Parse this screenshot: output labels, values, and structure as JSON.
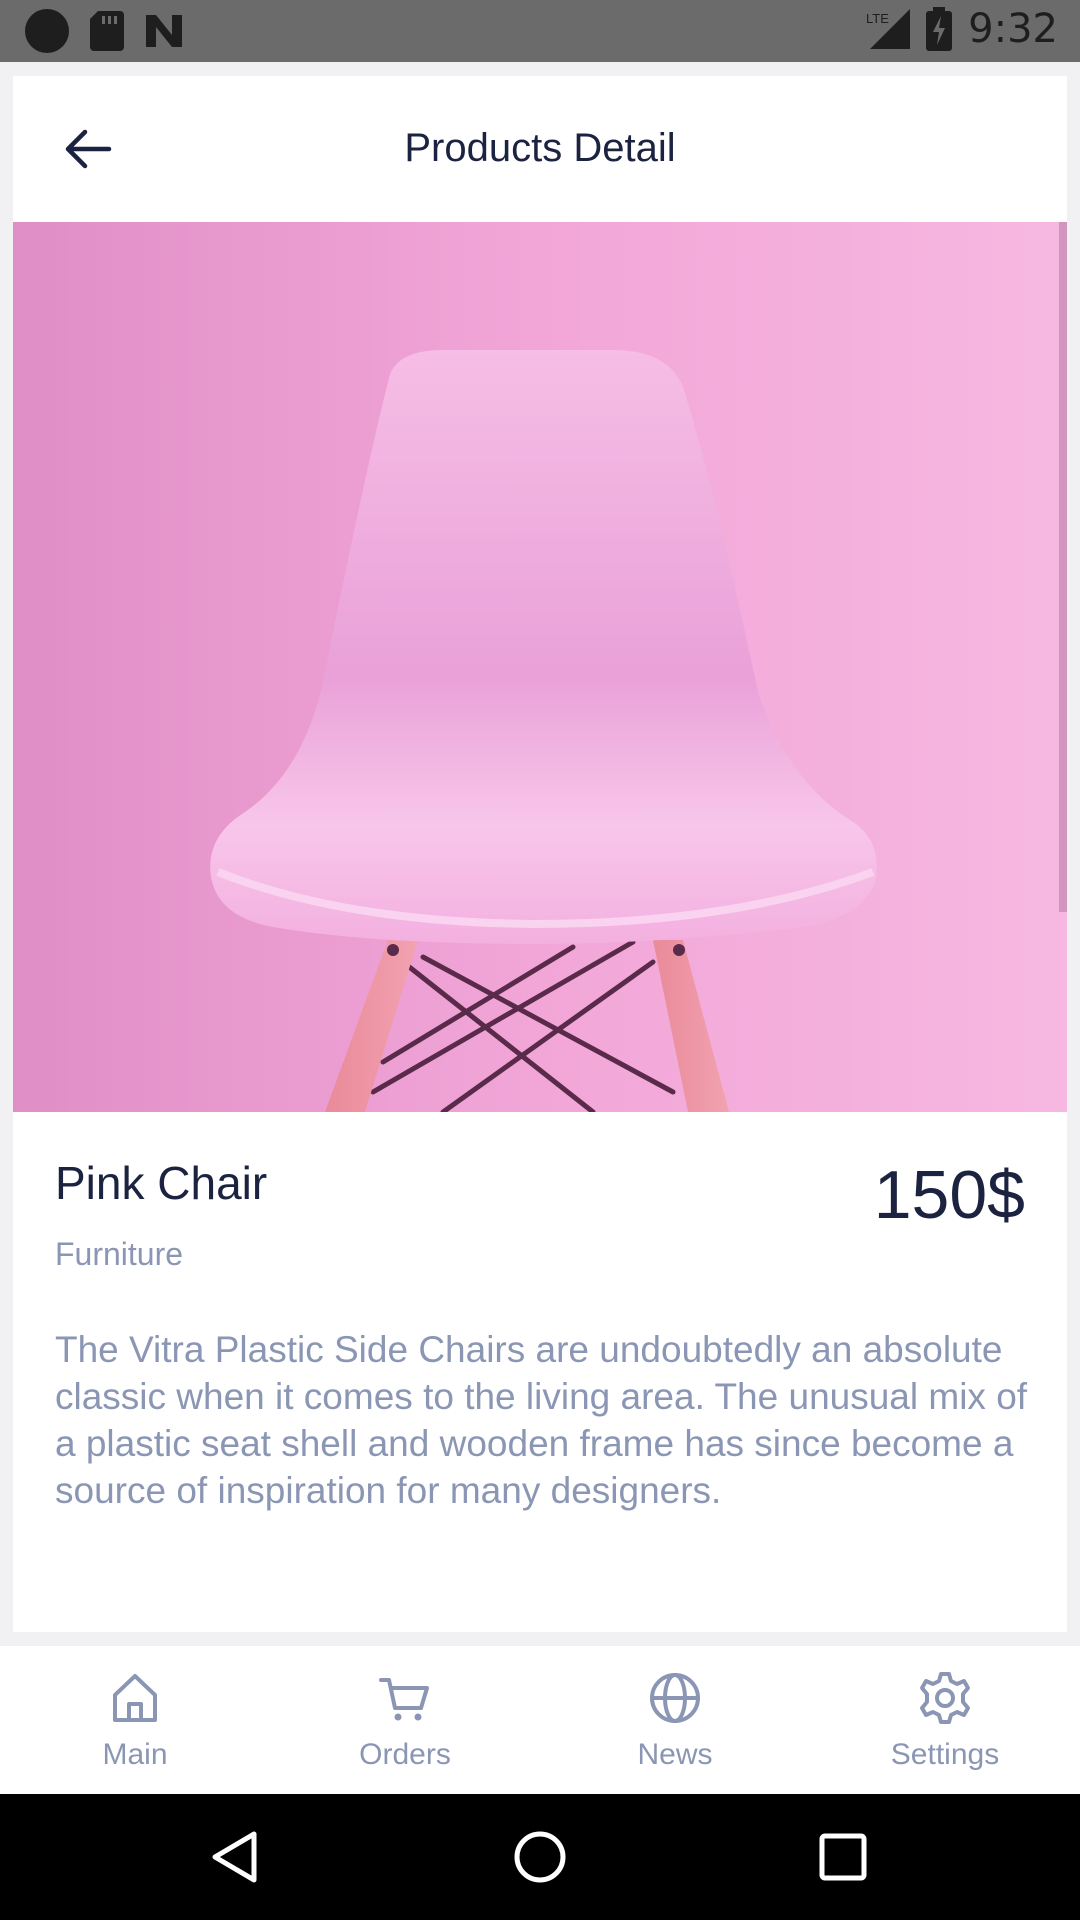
{
  "status_bar": {
    "time": "9:32",
    "network": "LTE",
    "icons": [
      "record-dot-icon",
      "sd-card-icon",
      "n-logo-icon",
      "signal-icon",
      "battery-charging-icon"
    ]
  },
  "header": {
    "title": "Products Detail",
    "back_icon": "arrow-left-icon"
  },
  "product": {
    "name": "Pink Chair",
    "category": "Furniture",
    "price": "150$",
    "description": "The Vitra Plastic Side Chairs are undoubtedly an absolute classic when it comes to the living area. The unusual mix of a plastic seat shell and wooden frame has since become a source of inspiration for many designers.",
    "image": "pink-chair-photo"
  },
  "bottom_nav": {
    "items": [
      {
        "label": "Main",
        "icon": "home-icon"
      },
      {
        "label": "Orders",
        "icon": "cart-icon"
      },
      {
        "label": "News",
        "icon": "globe-icon"
      },
      {
        "label": "Settings",
        "icon": "gear-icon"
      }
    ]
  },
  "system_nav": {
    "buttons": [
      "back-triangle-icon",
      "home-circle-icon",
      "recents-square-icon"
    ]
  },
  "colors": {
    "primary_text": "#1c2340",
    "secondary_text": "#8a96b3",
    "hero_background": "#ef9fd3",
    "chair": "#f5b6e2"
  }
}
